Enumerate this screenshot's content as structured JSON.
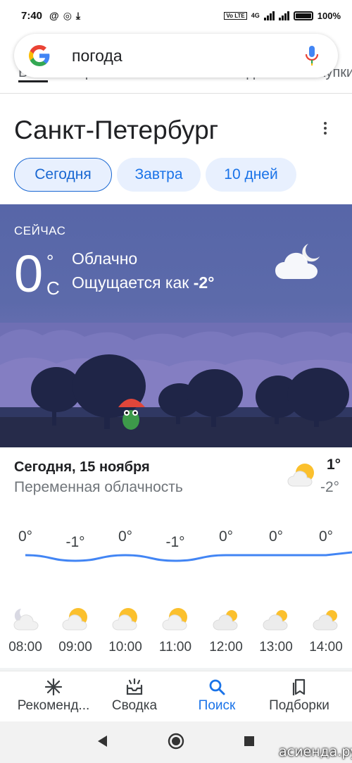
{
  "status_bar": {
    "time": "7:40",
    "battery": "100%",
    "net": "4G"
  },
  "search": {
    "query": "погода"
  },
  "tabs": [
    "Все",
    "Карты",
    "Новости",
    "Видео",
    "Покупки"
  ],
  "city": "Санкт-Петербург",
  "day_chips": [
    {
      "label": "Сегодня",
      "active": true
    },
    {
      "label": "Завтра",
      "active": false
    },
    {
      "label": "10 дней",
      "active": false
    }
  ],
  "current": {
    "label": "СЕЙЧАС",
    "temp": "0",
    "unit_symbol": "°",
    "unit": "C",
    "condition": "Облачно",
    "feels_prefix": "Ощущается как",
    "feels_value": "-2°",
    "icon": "cloud-moon-icon"
  },
  "today": {
    "title": "Сегодня, 15 ноября",
    "summary": "Переменная облачность",
    "high": "1°",
    "low": "-2°",
    "icon": "partly-cloudy-sun-icon"
  },
  "chart_data": {
    "type": "line",
    "x": [
      "08:00",
      "09:00",
      "10:00",
      "11:00",
      "12:00",
      "13:00",
      "14:00"
    ],
    "series": [
      {
        "values": [
          0,
          -1,
          0,
          -1,
          0,
          0,
          0
        ]
      }
    ],
    "labels": [
      "0°",
      "-1°",
      "0°",
      "-1°",
      "0°",
      "0°",
      "0°"
    ],
    "color": "#4285f4"
  },
  "hourly": [
    {
      "time": "08:00",
      "icon": "cloud-moon-icon"
    },
    {
      "time": "09:00",
      "icon": "sun-cloud-icon"
    },
    {
      "time": "10:00",
      "icon": "sun-cloud-icon"
    },
    {
      "time": "11:00",
      "icon": "sun-cloud-icon"
    },
    {
      "time": "12:00",
      "icon": "cloud-sun-small-icon"
    },
    {
      "time": "13:00",
      "icon": "cloud-sun-small-icon"
    },
    {
      "time": "14:00",
      "icon": "cloud-sun-small-icon"
    }
  ],
  "bottom_nav": [
    {
      "label": "Рекоменд...",
      "icon": "asterisk-icon",
      "active": false
    },
    {
      "label": "Сводка",
      "icon": "inbox-icon",
      "active": false
    },
    {
      "label": "Поиск",
      "icon": "search-icon",
      "active": true
    },
    {
      "label": "Подборки",
      "icon": "collections-icon",
      "active": false
    }
  ],
  "watermark": "асиенда.ру",
  "colors": {
    "accent": "#1a73e8",
    "panel": "#5c6aaa",
    "line": "#4285f4"
  }
}
